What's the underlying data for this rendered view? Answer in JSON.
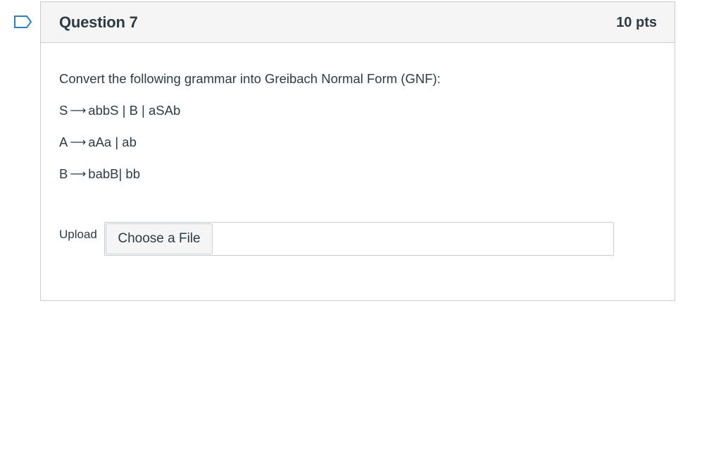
{
  "question": {
    "title": "Question 7",
    "points": "10 pts",
    "prompt": "Convert the following grammar into Greibach Normal Form (GNF):",
    "arrow_symbol": "⟶",
    "rules": [
      {
        "lhs": "S",
        "rhs": "abbS | B | aSAb"
      },
      {
        "lhs": "A",
        "rhs": "aAa | ab"
      },
      {
        "lhs": "B",
        "rhs": "babB| bb"
      }
    ],
    "upload": {
      "label": "Upload",
      "button_label": "Choose a File",
      "file_name": ""
    }
  },
  "colors": {
    "flag_outline": "#2d7fc4",
    "text": "#2d3b45",
    "header_bg": "#f5f5f5",
    "border": "#c7cdd1"
  },
  "icons": {
    "flag": "bookmark-flag-icon"
  }
}
